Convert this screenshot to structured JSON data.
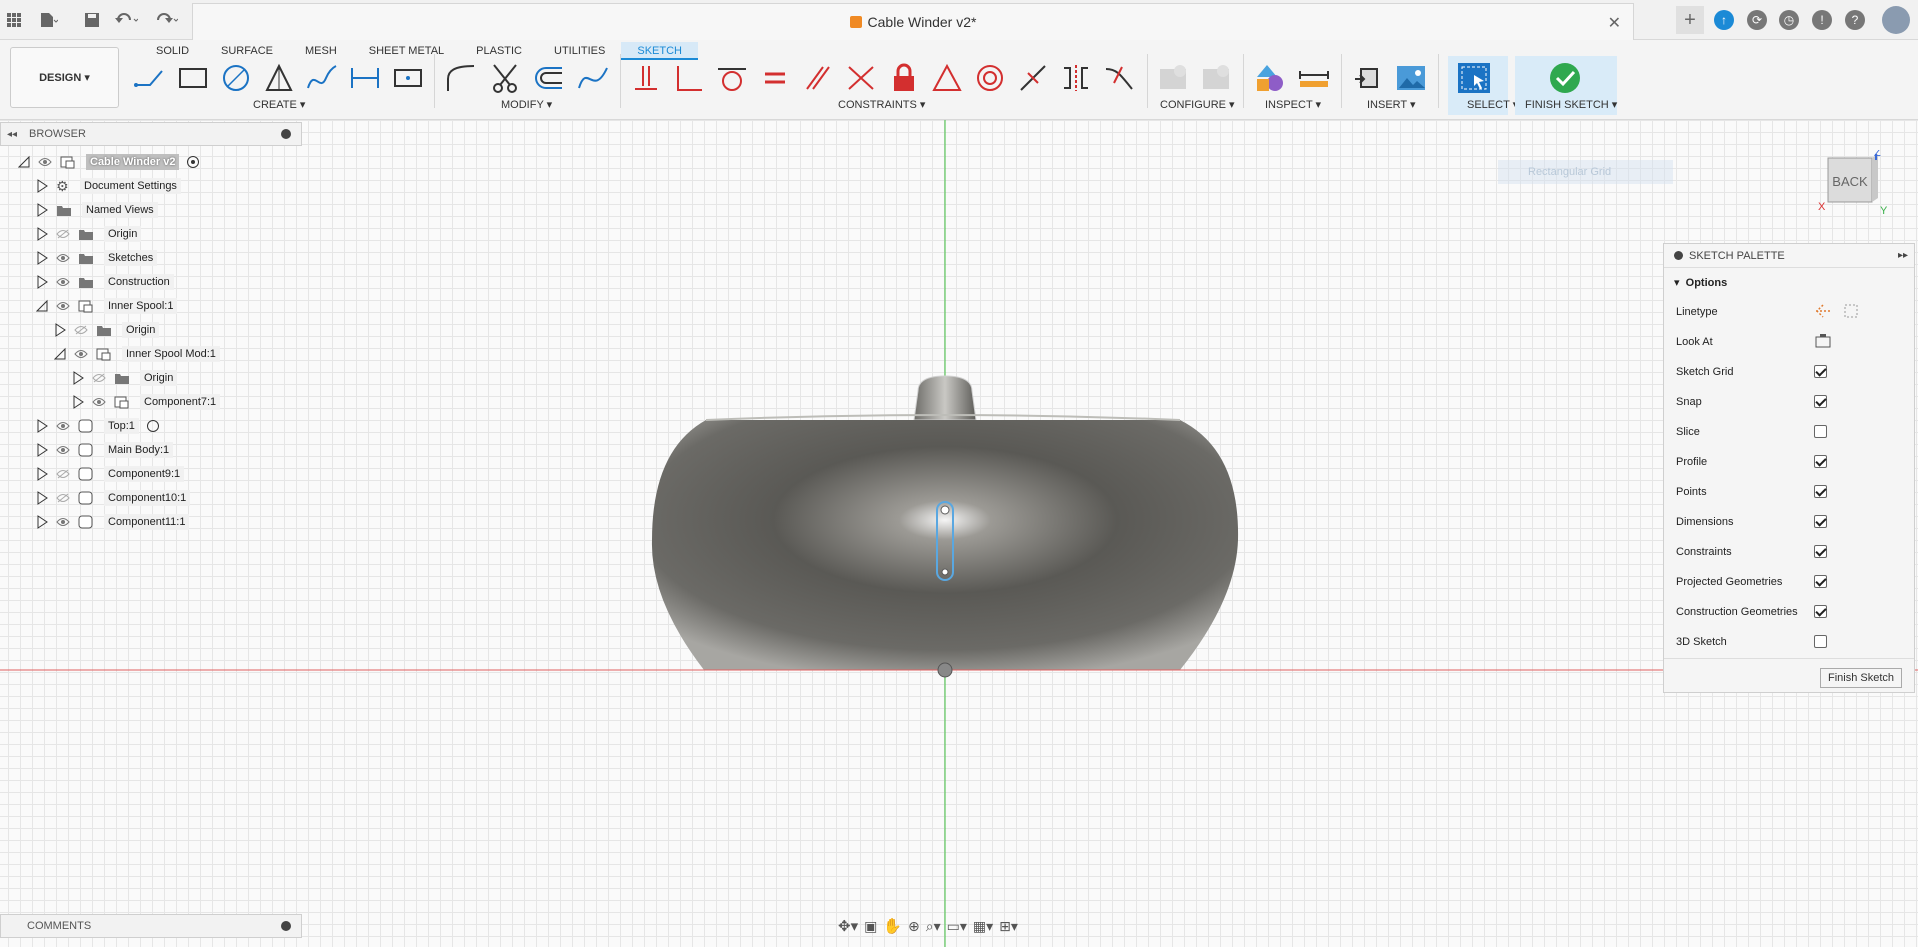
{
  "app": {
    "document_title": "Cable Winder v2*",
    "design_menu": "DESIGN"
  },
  "toolbar": {
    "tabs": [
      "SOLID",
      "SURFACE",
      "MESH",
      "SHEET METAL",
      "PLASTIC",
      "UTILITIES",
      "SKETCH"
    ],
    "active_tab": "SKETCH",
    "groups": {
      "create": "CREATE",
      "modify": "MODIFY",
      "constraints": "CONSTRAINTS",
      "configure": "CONFIGURE",
      "inspect": "INSPECT",
      "insert": "INSERT",
      "select": "SELECT",
      "finish": "FINISH SKETCH"
    }
  },
  "browser": {
    "title": "BROWSER",
    "root": "Cable Winder v2",
    "nodes": [
      {
        "label": "Document Settings"
      },
      {
        "label": "Named Views"
      },
      {
        "label": "Origin"
      },
      {
        "label": "Sketches"
      },
      {
        "label": "Construction"
      },
      {
        "label": "Inner Spool:1"
      },
      {
        "label": "Origin"
      },
      {
        "label": "Inner Spool Mod:1"
      },
      {
        "label": "Origin"
      },
      {
        "label": "Component7:1"
      },
      {
        "label": "Top:1"
      },
      {
        "label": "Main Body:1"
      },
      {
        "label": "Component9:1"
      },
      {
        "label": "Component10:1"
      },
      {
        "label": "Component11:1"
      }
    ]
  },
  "palette": {
    "title": "SKETCH PALETTE",
    "section": "Options",
    "linetype_label": "Linetype",
    "lookat_label": "Look At",
    "options": [
      {
        "label": "Sketch Grid",
        "checked": true
      },
      {
        "label": "Snap",
        "checked": true
      },
      {
        "label": "Slice",
        "checked": false
      },
      {
        "label": "Profile",
        "checked": true
      },
      {
        "label": "Points",
        "checked": true
      },
      {
        "label": "Dimensions",
        "checked": true
      },
      {
        "label": "Constraints",
        "checked": true
      },
      {
        "label": "Projected Geometries",
        "checked": true
      },
      {
        "label": "Construction Geometries",
        "checked": true
      },
      {
        "label": "3D Sketch",
        "checked": false
      }
    ],
    "finish_button": "Finish Sketch"
  },
  "viewcube": {
    "face": "BACK",
    "axis_z": "Z",
    "axis_x": "X",
    "axis_y": "Y"
  },
  "ghost_label": "Rectangular Grid",
  "comments": {
    "title": "COMMENTS"
  }
}
